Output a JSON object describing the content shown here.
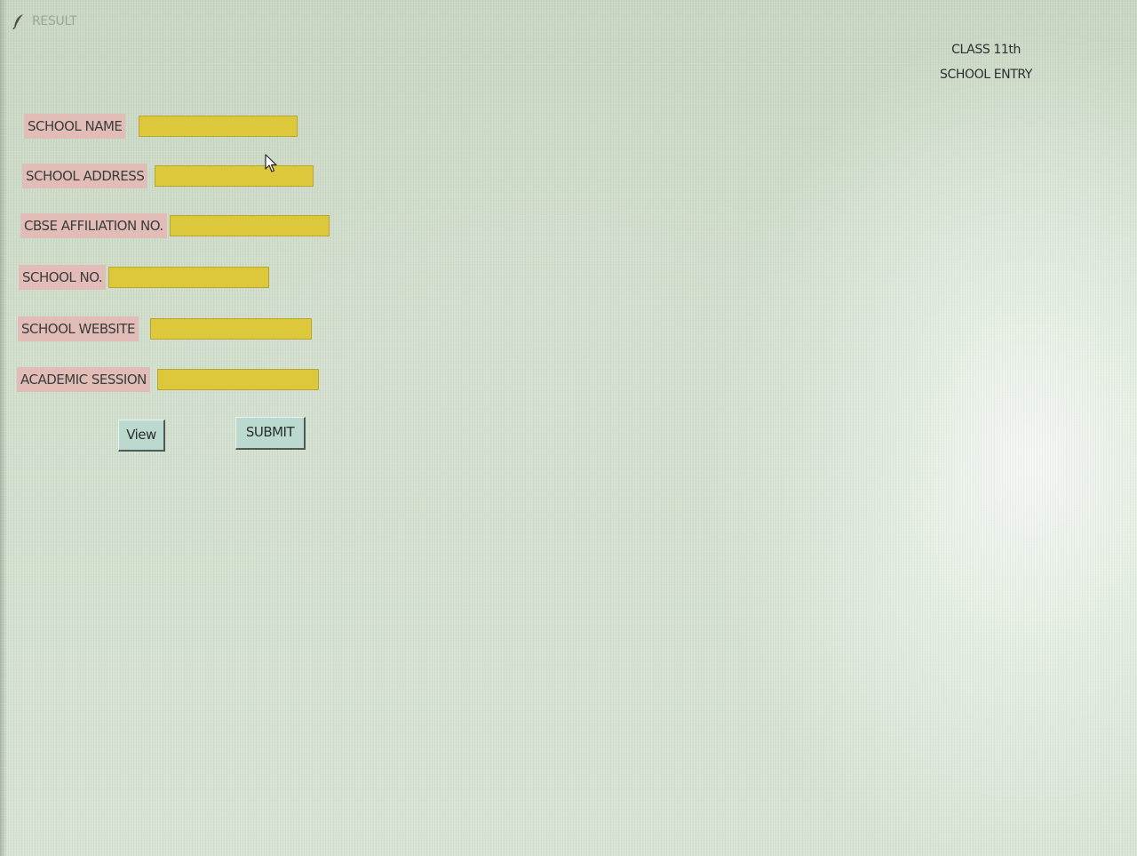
{
  "window": {
    "title": "RESULT",
    "icon": "feather-icon"
  },
  "header": {
    "line1": "CLASS 11th",
    "line2": "SCHOOL ENTRY"
  },
  "form": {
    "fields": [
      {
        "label": "SCHOOL NAME",
        "value": ""
      },
      {
        "label": "SCHOOL ADDRESS",
        "value": ""
      },
      {
        "label": "CBSE AFFILIATION NO.",
        "value": ""
      },
      {
        "label": "SCHOOL NO.",
        "value": ""
      },
      {
        "label": "SCHOOL WEBSITE",
        "value": ""
      },
      {
        "label": "ACADEMIC SESSION",
        "value": ""
      }
    ]
  },
  "buttons": {
    "view_label": "View",
    "submit_label": "SUBMIT"
  },
  "colors": {
    "background": "#d4e4cf",
    "label_bg": "#e2bdb7",
    "input_bg": "#dcc83a",
    "button_bg": "#bcd9cf"
  },
  "icons": {
    "cursor": "mouse-pointer-icon"
  }
}
